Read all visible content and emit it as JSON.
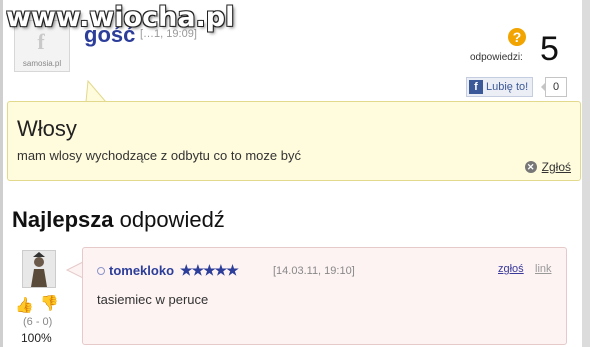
{
  "watermark": "www.wiocha.pl",
  "question": {
    "author": "gość",
    "date": "[…1, 19:09]",
    "avatar_caption": "samosia.pl",
    "answers_label": "odpowiedzi:",
    "answers_count": "5",
    "like_label": "Lubię to!",
    "like_count": "0",
    "title": "Włosy",
    "body": "mam wlosy wychodzące z odbytu co to moze być",
    "report_label": "Zgłoś"
  },
  "best_answer_heading": {
    "bold": "Najlepsza",
    "rest": " odpowiedź"
  },
  "answer": {
    "author": "tomekloko",
    "stars": "★★★★★",
    "date": "[14.03.11, 19:10]",
    "report_label": "zgłoś",
    "link_label": "link",
    "body": "tasiemiec w peruce",
    "votes": "(6 - 0)",
    "percent": "100%"
  },
  "colors": {
    "author_blue": "#2d3e9a",
    "question_bg": "#fffbdd",
    "answer_bg": "#fdf3f3",
    "accent_orange": "#f2a400",
    "facebook_blue": "#3b5998"
  },
  "icons": {
    "answers": "question-mark-icon",
    "facebook": "facebook-icon",
    "report": "close-circle-icon",
    "thumb_up": "thumb-up-icon",
    "thumb_down": "thumb-down-icon"
  }
}
